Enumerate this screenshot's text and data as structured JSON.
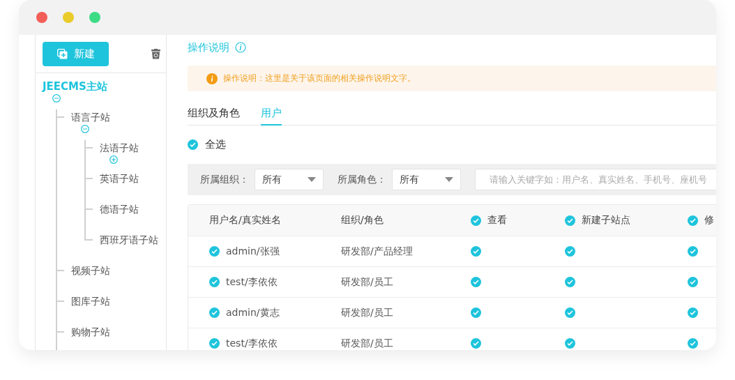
{
  "window": {
    "controls": [
      {
        "color": "#f25f58"
      },
      {
        "color": "#e9cc2c"
      },
      {
        "color": "#3ddc84"
      }
    ]
  },
  "sidebar": {
    "new_button": "新建",
    "tree": [
      {
        "label": "JEECMS主站",
        "expanded": true,
        "children": [
          {
            "label": "语言子站",
            "expanded": true,
            "children": [
              {
                "label": "法语子站",
                "expanded": false
              },
              {
                "label": "英语子站"
              },
              {
                "label": "德语子站"
              },
              {
                "label": "西班牙语子站"
              }
            ]
          },
          {
            "label": "视频子站"
          },
          {
            "label": "图库子站"
          },
          {
            "label": "购物子站"
          }
        ]
      }
    ]
  },
  "main": {
    "title": "操作说明",
    "notice": "操作说明：这里是关于该页面的相关操作说明文字。",
    "tabs": [
      {
        "label": "组织及角色",
        "selected": false
      },
      {
        "label": "用户",
        "selected": true
      }
    ],
    "select_all": {
      "label": "全选",
      "checked": true
    },
    "filters": [
      {
        "label": "所属组织：",
        "value": "所有"
      },
      {
        "label": "所属角色：",
        "value": "所有"
      }
    ],
    "search": {
      "placeholder": "请输入关键字如：用户名、真实姓名、手机号、座机号"
    },
    "table": {
      "columns": [
        {
          "label": "用户名/真实姓名"
        },
        {
          "label": "组织/角色"
        },
        {
          "label": "查看",
          "checked": true
        },
        {
          "label": "新建子站点",
          "checked": true
        },
        {
          "label": "修",
          "checked": true
        }
      ],
      "rows": [
        {
          "user": "admin/张强",
          "checked": true,
          "org": "研发部/产品经理",
          "permissions": [
            {
              "checked": true
            },
            {
              "checked": true
            },
            {
              "checked": true
            }
          ]
        },
        {
          "user": "test/李依依",
          "checked": true,
          "org": "研发部/员工",
          "permissions": [
            {
              "checked": true
            },
            {
              "checked": true
            },
            {
              "checked": true
            }
          ]
        },
        {
          "user": "admin/黄志",
          "checked": true,
          "org": "研发部/员工",
          "permissions": [
            {
              "checked": true
            },
            {
              "checked": true
            },
            {
              "checked": true
            }
          ]
        },
        {
          "user": "test/李依依",
          "checked": true,
          "org": "研发部/员工",
          "permissions": [
            {
              "checked": true
            },
            {
              "checked": true
            },
            {
              "checked": true
            }
          ]
        }
      ]
    }
  }
}
